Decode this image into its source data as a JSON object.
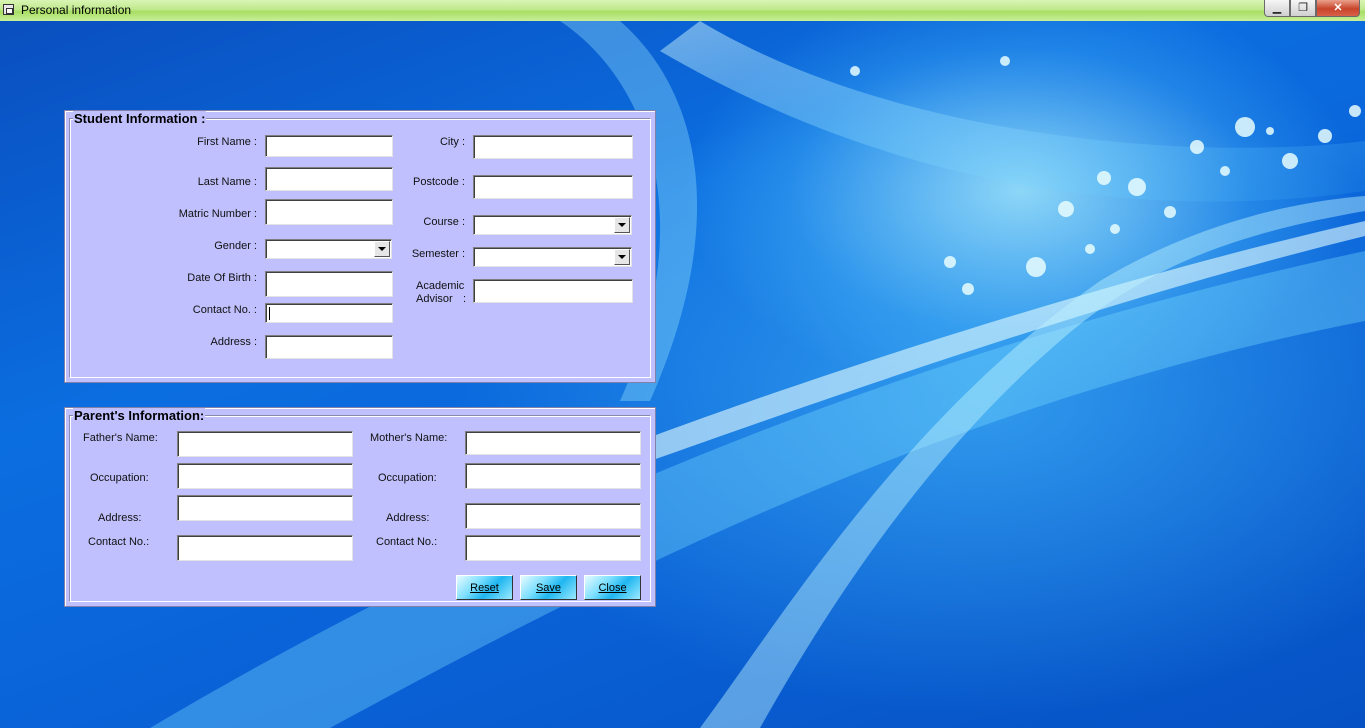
{
  "window": {
    "title": "Personal information",
    "minimize_glyph": "▁",
    "maximize_glyph": "❐",
    "close_glyph": "✕"
  },
  "student": {
    "legend": "Student Information :",
    "first_name_label": "First Name :",
    "last_name_label": "Last Name :",
    "matric_label": "Matric Number :",
    "gender_label": "Gender :",
    "dob_label": "Date Of Birth :",
    "contact_label": "Contact No. :",
    "address_label": "Address :",
    "city_label": "City :",
    "postcode_label": "Postcode :",
    "course_label": "Course :",
    "semester_label": "Semester :",
    "advisor_label_line1": "Academic",
    "advisor_label_line2": "Advisor",
    "advisor_colon": ":",
    "values": {
      "first_name": "",
      "last_name": "",
      "matric": "",
      "gender": "",
      "dob": "",
      "contact": "",
      "address": "",
      "city": "",
      "postcode": "",
      "course": "",
      "semester": "",
      "advisor": ""
    }
  },
  "parent": {
    "legend": "Parent's Information:",
    "father_name_label": "Father's Name:",
    "father_occupation_label": "Occupation:",
    "father_address_label": "Address:",
    "father_contact_label": "Contact No.:",
    "mother_name_label": "Mother's Name:",
    "mother_occupation_label": "Occupation:",
    "mother_address_label": "Address:",
    "mother_contact_label": "Contact No.:",
    "values": {
      "father_name": "",
      "father_occupation": "",
      "father_address": "",
      "father_contact": "",
      "mother_name": "",
      "mother_occupation": "",
      "mother_address": "",
      "mother_contact": ""
    }
  },
  "buttons": {
    "reset": "Reset",
    "save": "Save",
    "close": "Close"
  },
  "colors": {
    "panel_bg": "#c0c0ff",
    "titlebar_green": "#bfe98c",
    "desktop_blue": "#0a5fcf"
  }
}
